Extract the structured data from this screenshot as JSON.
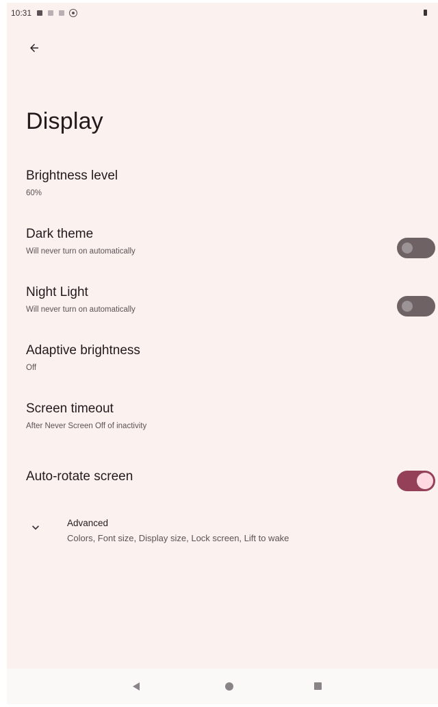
{
  "status_bar": {
    "time": "10:31",
    "icons": [
      "notification-icon",
      "data-icon",
      "sim-icon",
      "settings-gear-icon"
    ],
    "battery": "battery-icon"
  },
  "header": {
    "back_icon": "arrow-back-icon",
    "title": "Display"
  },
  "settings": [
    {
      "title": "Brightness level",
      "subtitle": "60%",
      "value": 0.6
    },
    {
      "title": "Dark theme",
      "subtitle": "Will never turn on automatically",
      "toggle": false
    },
    {
      "title": "Night Light",
      "subtitle": "Will never turn on automatically",
      "toggle": false
    },
    {
      "title": "Adaptive brightness",
      "subtitle": "Off"
    },
    {
      "title": "Screen timeout",
      "subtitle": "After Never Screen Off of inactivity"
    },
    {
      "title": "Auto-rotate screen",
      "toggle": true
    }
  ],
  "advanced": {
    "icon": "chevron-down-icon",
    "title": "Advanced",
    "subtitle": "Colors, Font size, Display size, Lock screen, Lift to wake"
  },
  "nav_bar": {
    "back": "nav-back-icon",
    "home": "nav-home-icon",
    "recents": "nav-recents-icon"
  },
  "colors": {
    "background": "#fbf1ee",
    "toggle_on": "#934058",
    "toggle_on_knob": "#ffd9e1",
    "toggle_off": "#6e6265",
    "text_primary": "#231a1e",
    "text_secondary": "#5b5256"
  }
}
